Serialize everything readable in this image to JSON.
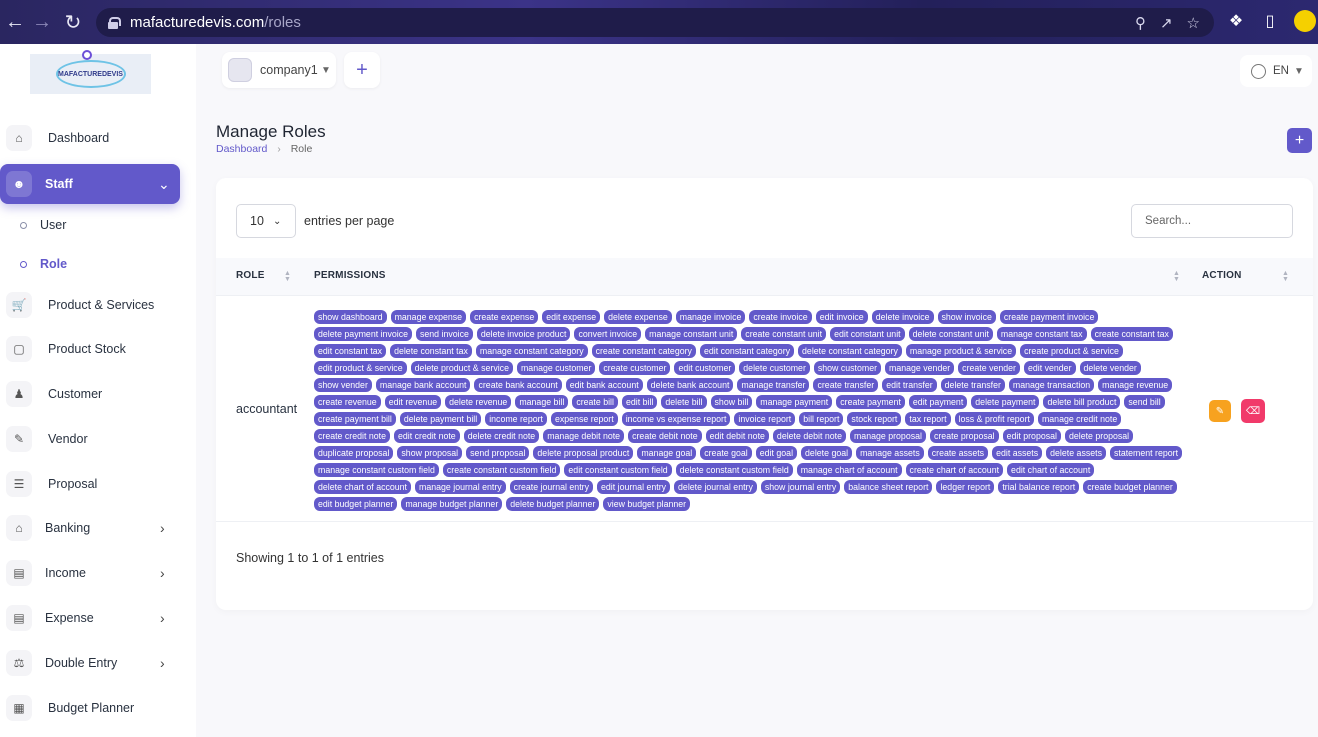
{
  "browser": {
    "url_host": "mafacturedevis.com",
    "url_path": "/roles"
  },
  "sidebar": {
    "logo_text": "MAFACTUREDEVIS",
    "items": [
      {
        "label": "Dashboard",
        "icon": "home-icon"
      },
      {
        "label": "Staff",
        "icon": "users-icon",
        "active": true
      },
      {
        "label": "Product & Services",
        "icon": "cart-icon"
      },
      {
        "label": "Product Stock",
        "icon": "box-icon"
      },
      {
        "label": "Customer",
        "icon": "user-plus-icon"
      },
      {
        "label": "Vendor",
        "icon": "note-icon"
      },
      {
        "label": "Proposal",
        "icon": "file-icon"
      },
      {
        "label": "Banking",
        "icon": "bank-icon"
      },
      {
        "label": "Income",
        "icon": "income-icon"
      },
      {
        "label": "Expense",
        "icon": "expense-icon"
      },
      {
        "label": "Double Entry",
        "icon": "scale-icon"
      },
      {
        "label": "Budget Planner",
        "icon": "budget-icon"
      }
    ],
    "staff_sub": [
      {
        "label": "User"
      },
      {
        "label": "Role",
        "active": true
      }
    ]
  },
  "topbar": {
    "company": "company1",
    "lang": "EN"
  },
  "page": {
    "title": "Manage Roles",
    "breadcrumb": [
      "Dashboard",
      "Role"
    ]
  },
  "table": {
    "per_page": "10",
    "per_page_label": "entries per page",
    "search_placeholder": "Search...",
    "headers": {
      "role": "ROLE",
      "permissions": "PERMISSIONS",
      "action": "ACTION"
    },
    "rows": [
      {
        "role": "accountant",
        "permissions": [
          "show dashboard",
          "manage expense",
          "create expense",
          "edit expense",
          "delete expense",
          "manage invoice",
          "create invoice",
          "edit invoice",
          "delete invoice",
          "show invoice",
          "create payment invoice",
          "delete payment invoice",
          "send invoice",
          "delete invoice product",
          "convert invoice",
          "manage constant unit",
          "create constant unit",
          "edit constant unit",
          "delete constant unit",
          "manage constant tax",
          "create constant tax",
          "edit constant tax",
          "delete constant tax",
          "manage constant category",
          "create constant category",
          "edit constant category",
          "delete constant category",
          "manage product & service",
          "create product & service",
          "edit product & service",
          "delete product & service",
          "manage customer",
          "create customer",
          "edit customer",
          "delete customer",
          "show customer",
          "manage vender",
          "create vender",
          "edit vender",
          "delete vender",
          "show vender",
          "manage bank account",
          "create bank account",
          "edit bank account",
          "delete bank account",
          "manage transfer",
          "create transfer",
          "edit transfer",
          "delete transfer",
          "manage transaction",
          "manage revenue",
          "create revenue",
          "edit revenue",
          "delete revenue",
          "manage bill",
          "create bill",
          "edit bill",
          "delete bill",
          "show bill",
          "manage payment",
          "create payment",
          "edit payment",
          "delete payment",
          "delete bill product",
          "send bill",
          "create payment bill",
          "delete payment bill",
          "income report",
          "expense report",
          "income vs expense report",
          "invoice report",
          "bill report",
          "stock report",
          "tax report",
          "loss & profit report",
          "manage credit note",
          "create credit note",
          "edit credit note",
          "delete credit note",
          "manage debit note",
          "create debit note",
          "edit debit note",
          "delete debit note",
          "manage proposal",
          "create proposal",
          "edit proposal",
          "delete proposal",
          "duplicate proposal",
          "show proposal",
          "send proposal",
          "delete proposal product",
          "manage goal",
          "create goal",
          "edit goal",
          "delete goal",
          "manage assets",
          "create assets",
          "edit assets",
          "delete assets",
          "statement report",
          "manage constant custom field",
          "create constant custom field",
          "edit constant custom field",
          "delete constant custom field",
          "manage chart of account",
          "create chart of account",
          "edit chart of account",
          "delete chart of account",
          "manage journal entry",
          "create journal entry",
          "edit journal entry",
          "delete journal entry",
          "show journal entry",
          "balance sheet report",
          "ledger report",
          "trial balance report",
          "create budget planner",
          "edit budget planner",
          "manage budget planner",
          "delete budget planner",
          "view budget planner"
        ]
      }
    ],
    "showing": "Showing 1 to 1 of 1 entries"
  },
  "colors": {
    "accent": "#6259ca",
    "edit": "#f7a21f",
    "delete": "#f13a6a"
  }
}
